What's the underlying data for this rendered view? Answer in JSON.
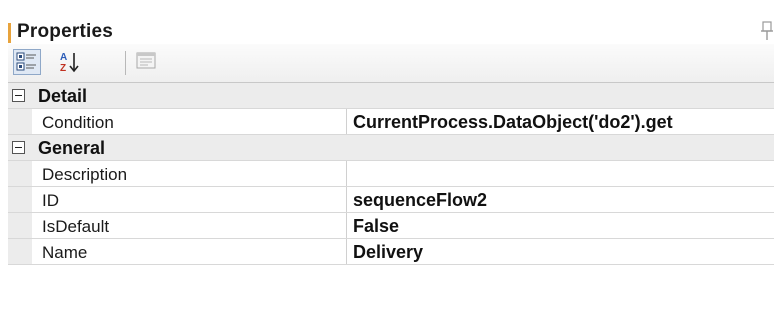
{
  "panel": {
    "title": "Properties"
  },
  "toolbar": {
    "categorized_icon": "categorized-icon",
    "alphabetical_icon": "sort-alphabetical-icon",
    "property_pages_icon": "property-pages-icon"
  },
  "grid": {
    "categories": [
      {
        "label": "Detail",
        "properties": [
          {
            "name": "Condition",
            "value": "CurrentProcess.DataObject('do2').get"
          }
        ]
      },
      {
        "label": "General",
        "properties": [
          {
            "name": "Description",
            "value": ""
          },
          {
            "name": "ID",
            "value": "sequenceFlow2"
          },
          {
            "name": "IsDefault",
            "value": "False"
          },
          {
            "name": "Name",
            "value": "Delivery"
          }
        ]
      }
    ]
  },
  "colors": {
    "title_accent": "#e8a33c",
    "category_background": "#ececec",
    "toolbar_selected": "#dfe8f4"
  }
}
